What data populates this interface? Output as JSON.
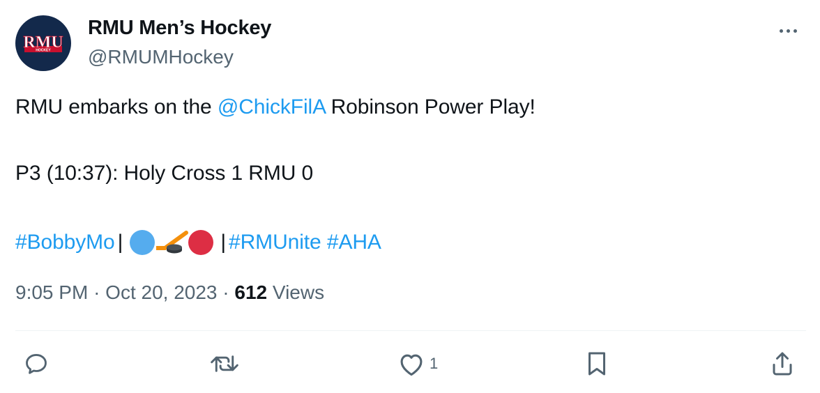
{
  "author": {
    "name": "RMU Men’s Hockey",
    "handle": "@RMUMHockey",
    "avatar_text": "RMU",
    "avatar_subtext": "HOCKEY"
  },
  "tweet": {
    "line1_before": "RMU embarks on the ",
    "line1_mention": "@ChickFilA",
    "line1_after": " Robinson Power Play!",
    "line2": "P3 (10:37): Holy Cross 1 RMU 0",
    "hashtag_1": "#BobbyMo",
    "separator": "|",
    "hashtag_2": "#RMUnite",
    "hashtag_3": "#AHA",
    "emoji_names": [
      "blue-circle",
      "ice-hockey",
      "red-circle"
    ]
  },
  "meta": {
    "time": "9:05 PM",
    "dot": "·",
    "date": "Oct 20, 2023",
    "views_count": "612",
    "views_label": "Views"
  },
  "actions": {
    "reply_icon": "reply-icon",
    "retweet_icon": "retweet-icon",
    "like_icon": "heart-icon",
    "like_count": "1",
    "bookmark_icon": "bookmark-icon",
    "share_icon": "share-icon"
  },
  "colors": {
    "link": "#1d9bf0",
    "secondary_text": "#536471",
    "primary_text": "#0f1419",
    "avatar_bg": "#13294b",
    "avatar_accent": "#c8102e"
  }
}
